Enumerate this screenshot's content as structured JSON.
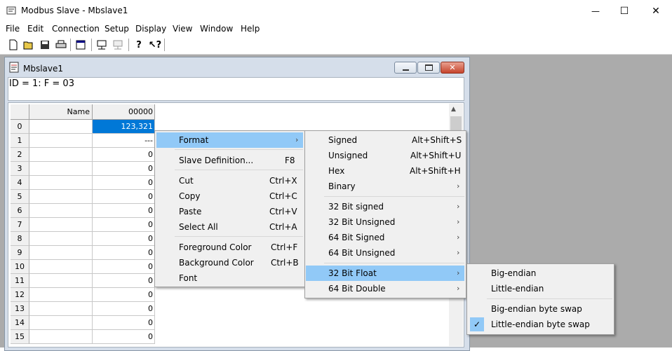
{
  "window": {
    "title": "Modbus Slave - Mbslave1",
    "minimize": "—",
    "maximize": "☐",
    "close": "✕"
  },
  "menubar": [
    "File",
    "Edit",
    "Connection",
    "Setup",
    "Display",
    "View",
    "Window",
    "Help"
  ],
  "toolbar": {
    "icons": [
      "new-icon",
      "open-icon",
      "save-icon",
      "print-icon",
      "window-icon",
      "connect-icon",
      "disconnect-icon",
      "help-icon",
      "context-help-icon"
    ]
  },
  "child": {
    "title": "Mbslave1",
    "id_line": "ID = 1: F = 03"
  },
  "grid": {
    "col_name_header": "Name",
    "col_value_header": "00000",
    "rows": [
      {
        "index": "0",
        "value": "123,321"
      },
      {
        "index": "1",
        "value": "---"
      },
      {
        "index": "2",
        "value": "0"
      },
      {
        "index": "3",
        "value": "0"
      },
      {
        "index": "4",
        "value": "0"
      },
      {
        "index": "5",
        "value": "0"
      },
      {
        "index": "6",
        "value": "0"
      },
      {
        "index": "7",
        "value": "0"
      },
      {
        "index": "8",
        "value": "0"
      },
      {
        "index": "9",
        "value": "0"
      },
      {
        "index": "10",
        "value": "0"
      },
      {
        "index": "11",
        "value": "0"
      },
      {
        "index": "12",
        "value": "0"
      },
      {
        "index": "13",
        "value": "0"
      },
      {
        "index": "14",
        "value": "0"
      },
      {
        "index": "15",
        "value": "0"
      }
    ]
  },
  "context_menu": {
    "format": "Format",
    "slave_definition": "Slave Definition...",
    "slave_definition_key": "F8",
    "cut": "Cut",
    "cut_key": "Ctrl+X",
    "copy": "Copy",
    "copy_key": "Ctrl+C",
    "paste": "Paste",
    "paste_key": "Ctrl+V",
    "select_all": "Select All",
    "select_all_key": "Ctrl+A",
    "foreground_color": "Foreground Color",
    "foreground_color_key": "Ctrl+F",
    "background_color": "Background Color",
    "background_color_key": "Ctrl+B",
    "font": "Font"
  },
  "format_menu": {
    "signed": "Signed",
    "signed_key": "Alt+Shift+S",
    "unsigned": "Unsigned",
    "unsigned_key": "Alt+Shift+U",
    "hex": "Hex",
    "hex_key": "Alt+Shift+H",
    "binary": "Binary",
    "bit32_signed": "32 Bit signed",
    "bit32_unsigned": "32 Bit Unsigned",
    "bit64_signed": "64 Bit Signed",
    "bit64_unsigned": "64 Bit Unsigned",
    "bit32_float": "32 Bit Float",
    "bit64_double": "64 Bit Double"
  },
  "float_menu": {
    "big_endian": "Big-endian",
    "little_endian": "Little-endian",
    "big_endian_swap": "Big-endian byte swap",
    "little_endian_swap": "Little-endian byte swap",
    "checked": "Little-endian byte swap"
  },
  "colors": {
    "highlight": "#91c9f7",
    "selected_cell": "#0078d7",
    "mdi_background": "#ababab"
  }
}
